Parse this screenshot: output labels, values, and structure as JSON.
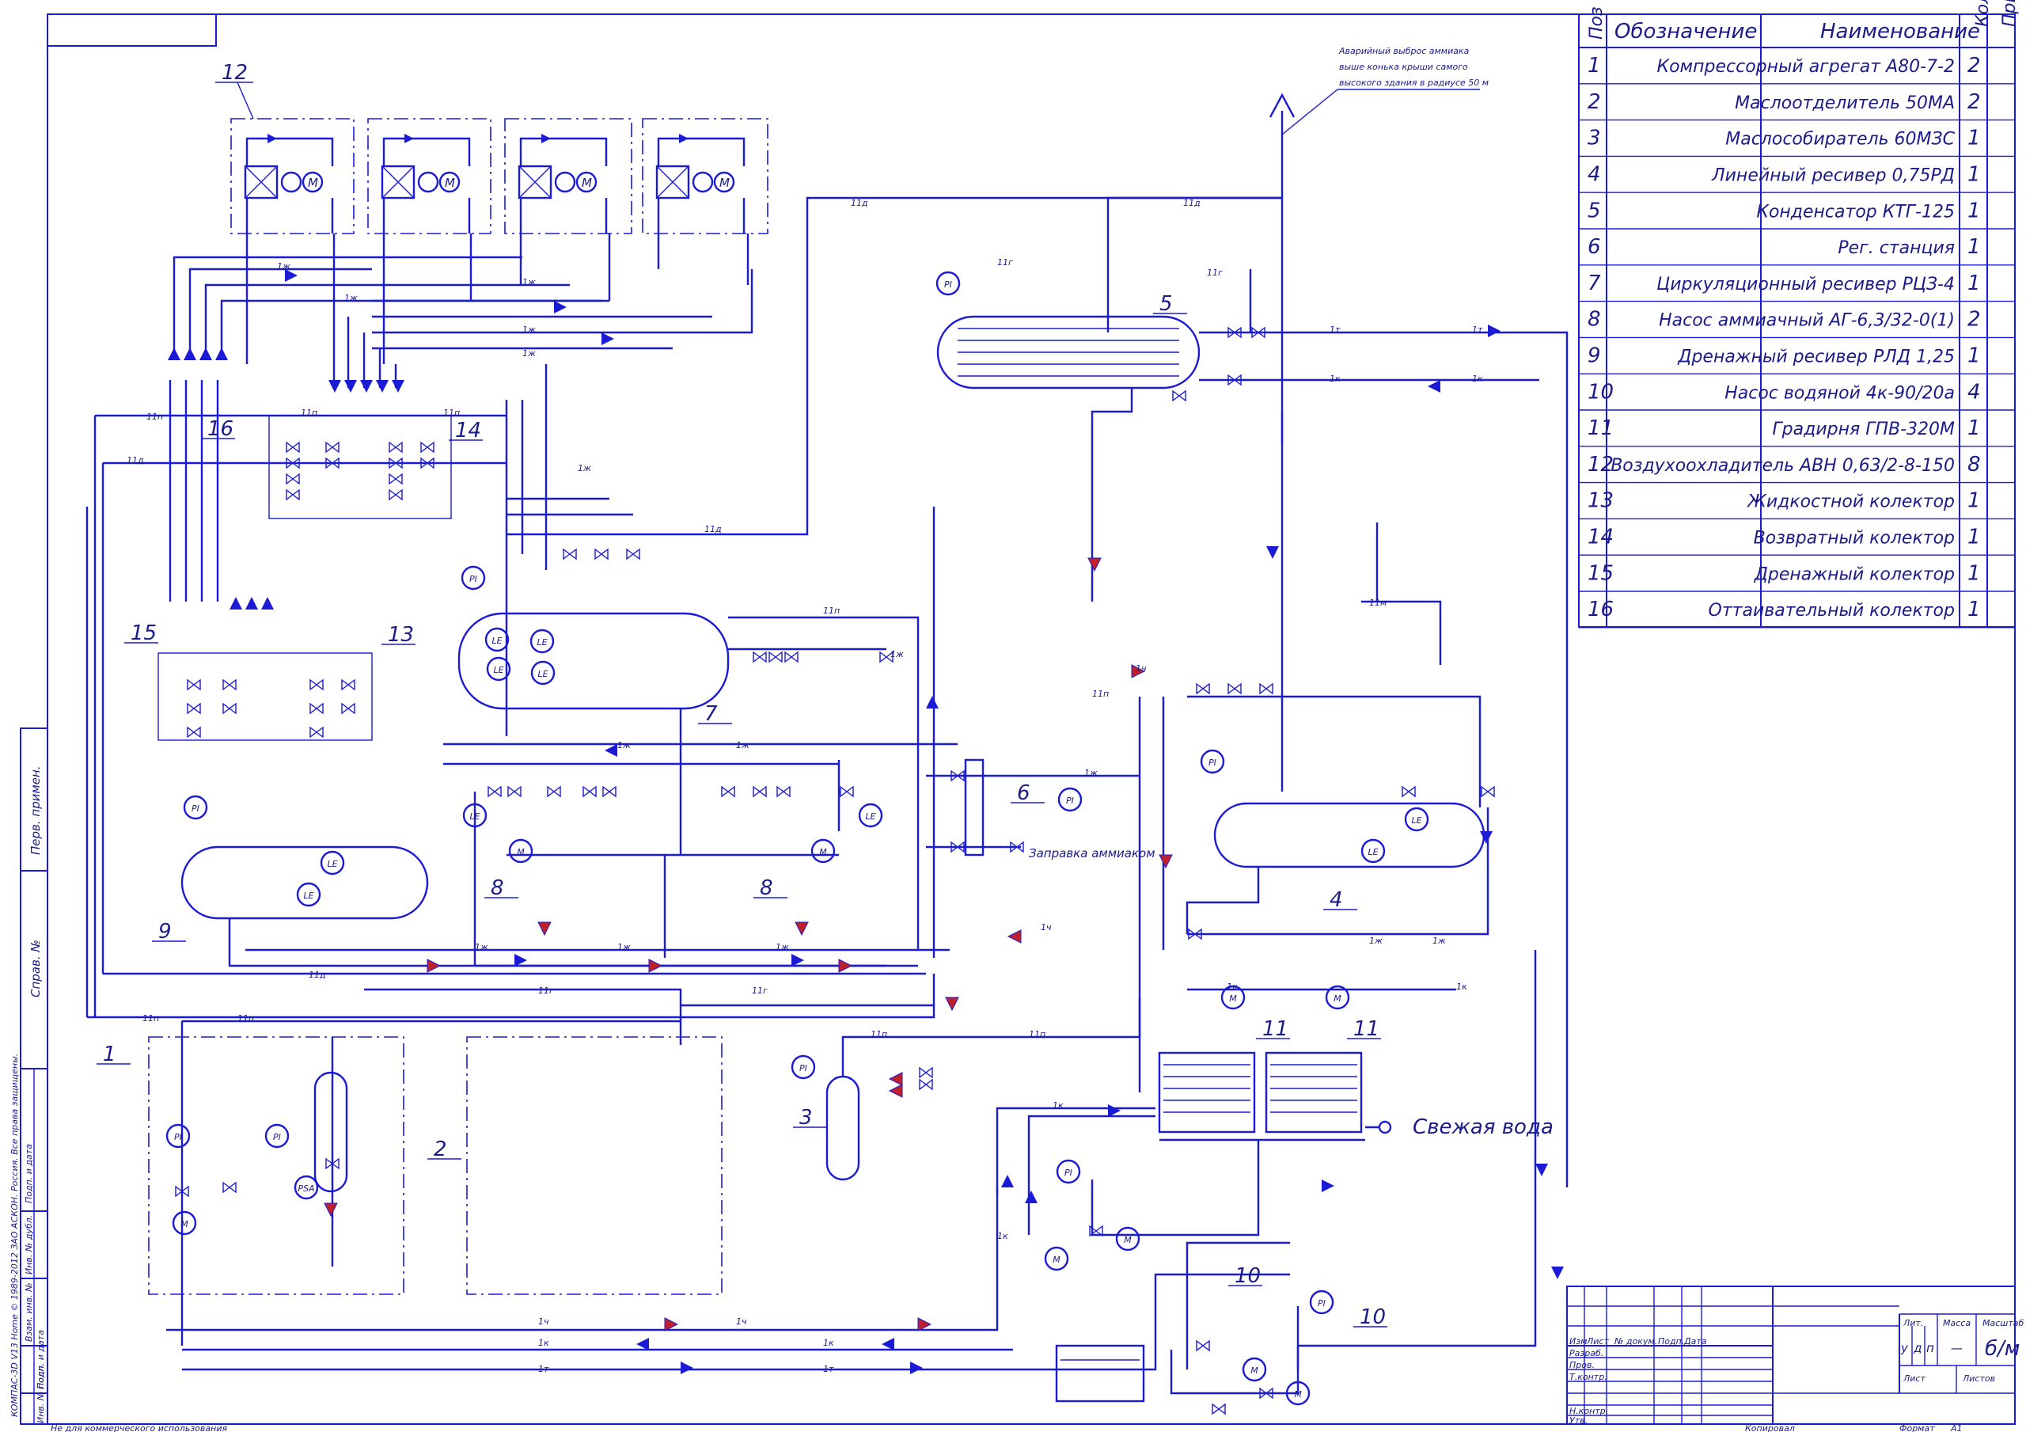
{
  "note_emergency": [
    "Аварийный выброс аммиака",
    "выше конька крыши самого",
    "высокого здания в радиусе 50 м"
  ],
  "table": {
    "headers": {
      "pos": "Поз",
      "designation": "Обозначение",
      "name": "Наименование",
      "qty": "Кол",
      "note": "Прим"
    },
    "rows": [
      {
        "pos": "1",
        "name": "Компрессорный агрегат А80-7-2",
        "qty": "2"
      },
      {
        "pos": "2",
        "name": "Маслоотделитель 50МА",
        "qty": "2"
      },
      {
        "pos": "3",
        "name": "Маслособиратель 60МЗС",
        "qty": "1"
      },
      {
        "pos": "4",
        "name": "Линейный ресивер 0,75РД",
        "qty": "1"
      },
      {
        "pos": "5",
        "name": "Конденсатор КТГ-125",
        "qty": "1"
      },
      {
        "pos": "6",
        "name": "Рег. станция",
        "qty": "1"
      },
      {
        "pos": "7",
        "name": "Циркуляционный ресивер РЦЗ-4",
        "qty": "1"
      },
      {
        "pos": "8",
        "name": "Насос аммиачный АГ-6,3/32-0(1)",
        "qty": "2"
      },
      {
        "pos": "9",
        "name": "Дренажный ресивер РЛД 1,25",
        "qty": "1"
      },
      {
        "pos": "10",
        "name": "Насос водяной 4к-90/20а",
        "qty": "4"
      },
      {
        "pos": "11",
        "name": "Градирня ГПВ-320М",
        "qty": "1"
      },
      {
        "pos": "12",
        "name": "Воздухоохладитель АВН 0,63/2-8-150",
        "qty": "8"
      },
      {
        "pos": "13",
        "name": "Жидкостной колектор",
        "qty": "1"
      },
      {
        "pos": "14",
        "name": "Возвратный колектор",
        "qty": "1"
      },
      {
        "pos": "15",
        "name": "Дренажный колектор",
        "qty": "1"
      },
      {
        "pos": "16",
        "name": "Оттаивательный колектор",
        "qty": "1"
      }
    ]
  },
  "labels": {
    "fresh_water": "Свежая вода",
    "ammonia_fill": "Заправка аммиаком",
    "pi": "PI",
    "le": "LE",
    "psa": "PSA",
    "motor": "M"
  },
  "callouts": [
    "1",
    "2",
    "3",
    "4",
    "5",
    "6",
    "7",
    "8",
    "8",
    "9",
    "10",
    "10",
    "11",
    "11",
    "12",
    "13",
    "14",
    "15",
    "16"
  ],
  "line_codes": {
    "liquid": "1ж",
    "return": "1ж",
    "hot_gas": "11г",
    "drain": "11д",
    "oil": "11п",
    "water_return": "1т",
    "water_supply": "1к",
    "cold_water": "1ч",
    "oil_drain": "11м"
  },
  "stamp": {
    "cols": [
      "Изм",
      "Лист",
      "№ докум.",
      "Подп.",
      "Дата"
    ],
    "rows": [
      "Разраб.",
      "Пров.",
      "Т.контр.",
      "Н.контр.",
      "Утв."
    ],
    "lit": "Лит.",
    "mass": "Масса",
    "scale": "Масштаб",
    "lit_letters": [
      "у",
      "д",
      "п"
    ],
    "mass_value": "—",
    "scale_value": "б/м",
    "sheet": "Лист",
    "sheets": "Листов"
  },
  "footer": {
    "left": "Не для коммерческого использования",
    "copied": "Копировал",
    "format": "Формат",
    "format_value": "A1"
  },
  "side_strip": {
    "cells": [
      "Перв. примен.",
      "Справ. №",
      "Подп. и дата",
      "Инв. № дубл.",
      "Взам. инв. №",
      "Подп. и дата",
      "Инв. № подл."
    ],
    "copyright": "КОМПАС-3D V13 Home © 1989-2012 ЗАО АСКОН. Россия. Все права защищены."
  }
}
